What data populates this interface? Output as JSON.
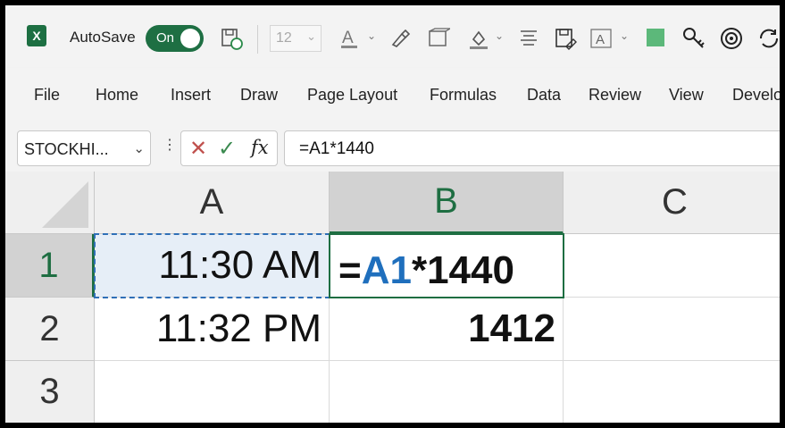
{
  "quick_access": {
    "autosave_label": "AutoSave",
    "autosave_state": "On",
    "font_size": "12",
    "icons": [
      "excel-logo",
      "save-sync-icon",
      "font-color-icon",
      "format-painter-icon",
      "3d-model-icon",
      "fill-color-icon",
      "align-icon",
      "save-as-icon",
      "text-box-icon",
      "green-fill-icon",
      "key-icon",
      "record-icon",
      "refresh-icon"
    ]
  },
  "ribbon": {
    "tabs": [
      "File",
      "Home",
      "Insert",
      "Draw",
      "Page Layout",
      "Formulas",
      "Data",
      "Review",
      "View",
      "Develo"
    ]
  },
  "formula_bar": {
    "name_box": "STOCKHI...",
    "fx": "fx",
    "formula": "=A1*1440"
  },
  "sheet": {
    "columns": [
      "A",
      "B",
      "C"
    ],
    "rows": [
      "1",
      "2",
      "3"
    ],
    "cells": {
      "A1": "11:30 AM",
      "A2": "11:32 PM",
      "B2": "1412"
    },
    "editing": {
      "cell": "B1",
      "prefix": "=",
      "ref": "A1",
      "suffix": "*1440"
    }
  },
  "colors": {
    "accent": "#1e6f43",
    "ref_blue": "#1f6fbd",
    "cancel_red": "#c0504d"
  }
}
